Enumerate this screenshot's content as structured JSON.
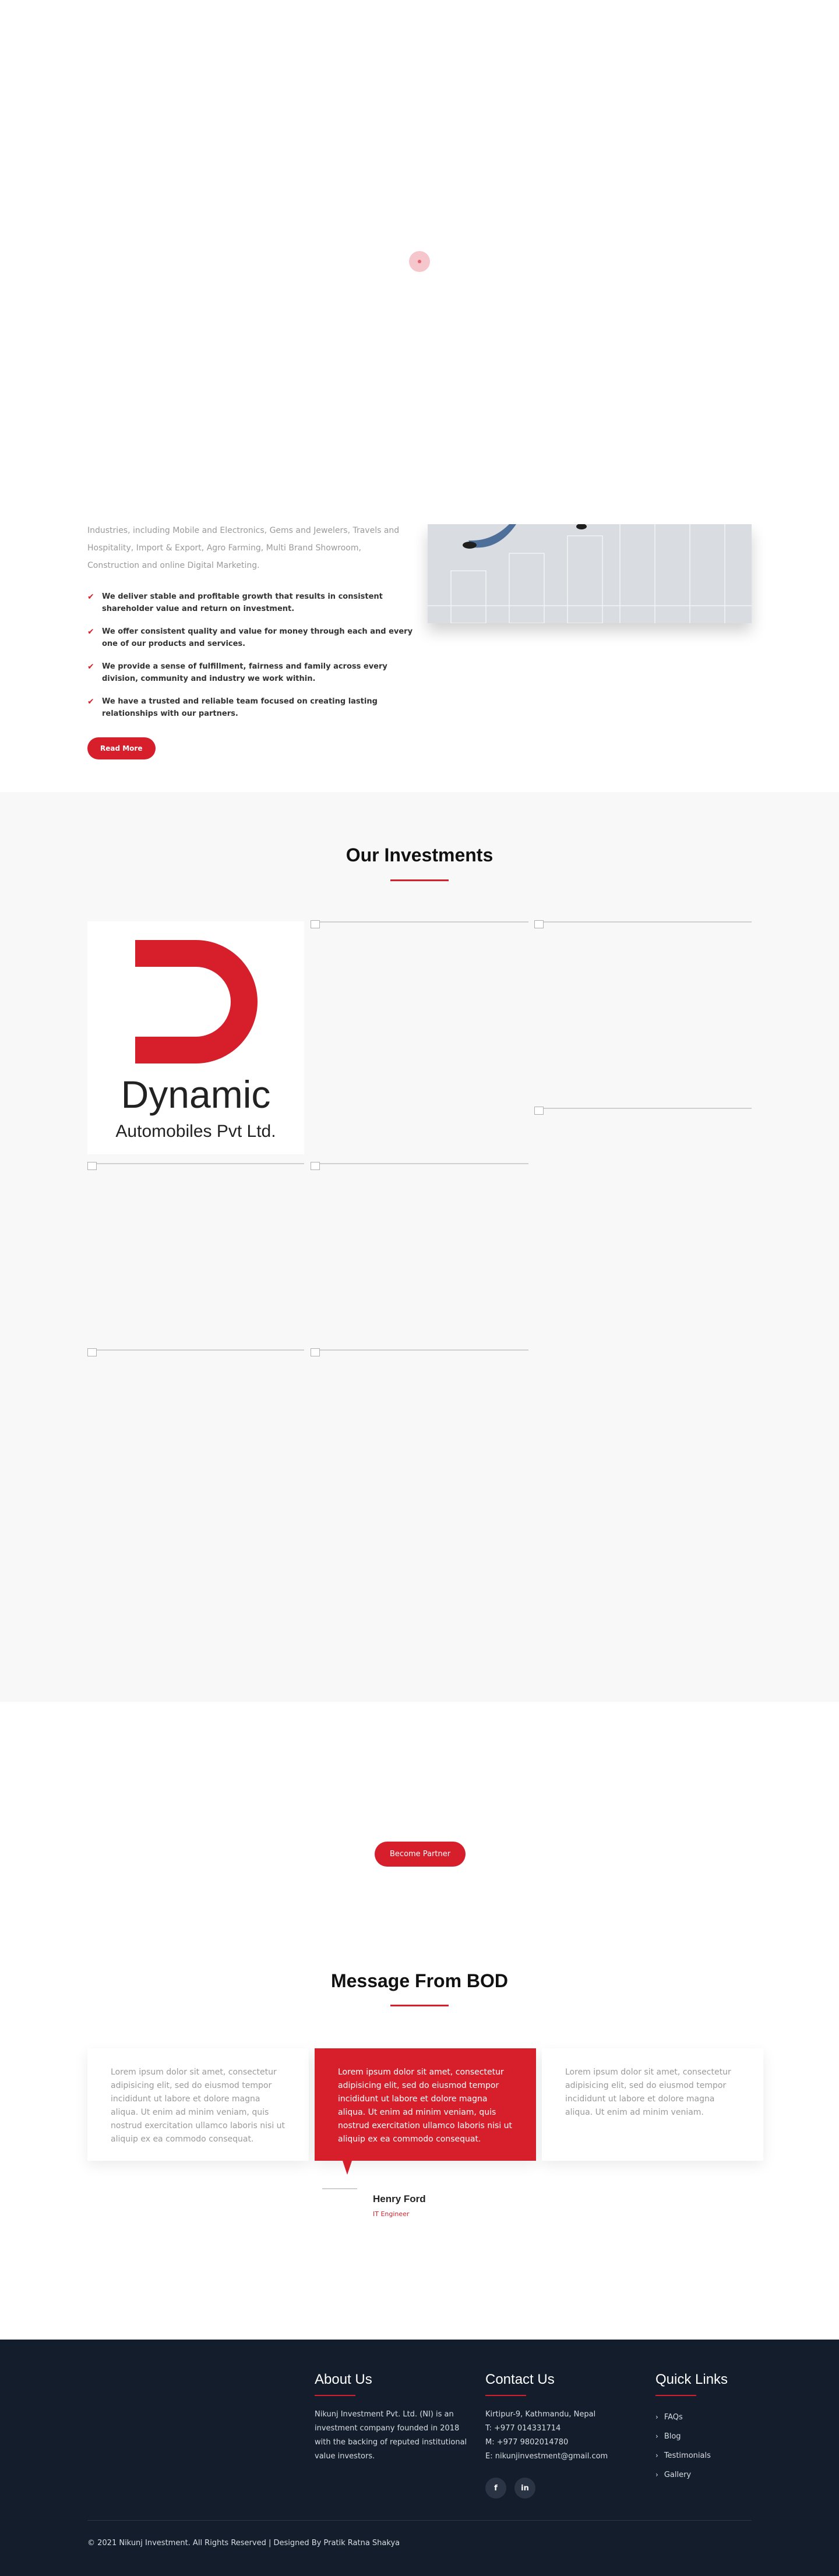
{
  "about": {
    "paragraph": "Industries, including Mobile and Electronics, Gems and Jewelers, Travels and Hospitality, Import & Export, Agro Farming, Multi Brand Showroom, Construction and online Digital Marketing.",
    "points": [
      "We deliver stable and profitable growth that results in consistent shareholder value and return on investment.",
      "We offer consistent quality and value for money through each and every one of our products and services.",
      "We provide a sense of fulfillment, fairness and family across every division, community and industry we work within.",
      "We have a trusted and reliable team focused on creating lasting relationships with our partners."
    ],
    "read_more": "Read More",
    "check_icon": "check-icon"
  },
  "investments": {
    "title": "Our Investments",
    "logo": {
      "name": "Dynamic",
      "sub": "Automobiles Pvt Ltd."
    }
  },
  "partner": {
    "button": "Become Partner"
  },
  "bod": {
    "title": "Message From BOD",
    "messages": [
      "Lorem ipsum dolor sit amet, consectetur adipisicing elit, sed do eiusmod tempor incididunt ut labore et dolore magna aliqua. Ut enim ad minim veniam, quis nostrud exercitation ullamco laboris nisi ut aliquip ex ea commodo consequat.",
      "Lorem ipsum dolor sit amet, consectetur adipisicing elit, sed do eiusmod tempor incididunt ut labore et dolore magna aliqua. Ut enim ad minim veniam, quis nostrud exercitation ullamco laboris nisi ut aliquip ex ea commodo consequat.",
      "Lorem ipsum dolor sit amet, consectetur adipisicing elit, sed do eiusmod tempor incididunt ut labore et dolore magna aliqua. Ut enim ad minim veniam."
    ],
    "person_name": "Henry Ford",
    "person_role": "IT Engineer"
  },
  "footer": {
    "about_title": "About Us",
    "about_text": "Nikunj Investment Pvt. Ltd. (NI) is an investment company founded in 2018 with the backing of reputed institutional value investors.",
    "contact_title": "Contact Us",
    "address": "Kirtipur-9, Kathmandu, Nepal",
    "phone": "T: +977 014331714",
    "mobile": "M: +977 9802014780",
    "email": "E: nikunjinvestment@gmail.com",
    "social": [
      "f",
      "in"
    ],
    "links_title": "Quick Links",
    "links": [
      "FAQs",
      "Blog",
      "Testimonials",
      "Gallery"
    ],
    "copyright": "© 2021 Nikunj Investment. All Rights Reserved | Designed By Pratik Ratna Shakya"
  },
  "colors": {
    "accent": "#d71f2c",
    "footer_bg": "#131d2c",
    "section_bg": "#f8f8f8"
  }
}
